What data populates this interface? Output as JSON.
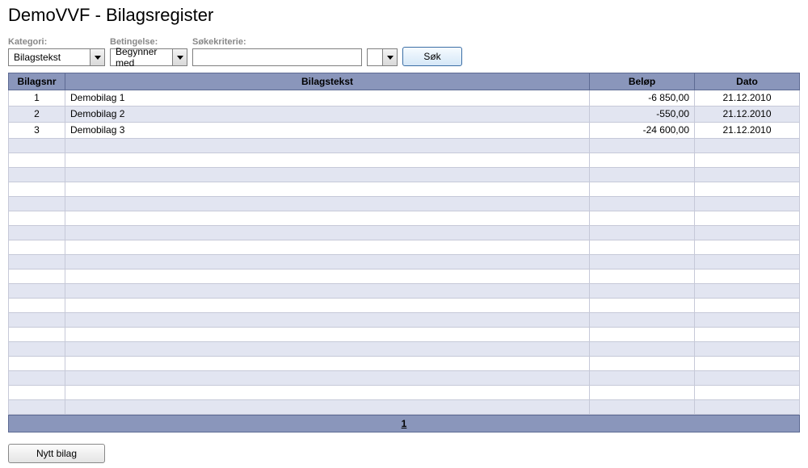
{
  "page": {
    "title": "DemoVVF - Bilagsregister"
  },
  "filters": {
    "kategori_label": "Kategori:",
    "kategori_value": "Bilagstekst",
    "betingelse_label": "Betingelse:",
    "betingelse_value": "Begynner med",
    "sokekriterie_label": "Søkekriterie:",
    "sokekriterie_value": "",
    "extra_select_value": "",
    "sok_button": "Søk"
  },
  "table": {
    "columns": {
      "nr": "Bilagsnr",
      "text": "Bilagstekst",
      "amount": "Beløp",
      "date": "Dato"
    },
    "rows": [
      {
        "nr": "1",
        "text": "Demobilag 1",
        "amount": "-6 850,00",
        "date": "21.12.2010"
      },
      {
        "nr": "2",
        "text": "Demobilag 2",
        "amount": "-550,00",
        "date": "21.12.2010"
      },
      {
        "nr": "3",
        "text": "Demobilag 3",
        "amount": "-24 600,00",
        "date": "21.12.2010"
      }
    ],
    "total_visible_rows": 22
  },
  "pager": {
    "current": "1"
  },
  "footer": {
    "nytt_bilag": "Nytt bilag"
  }
}
